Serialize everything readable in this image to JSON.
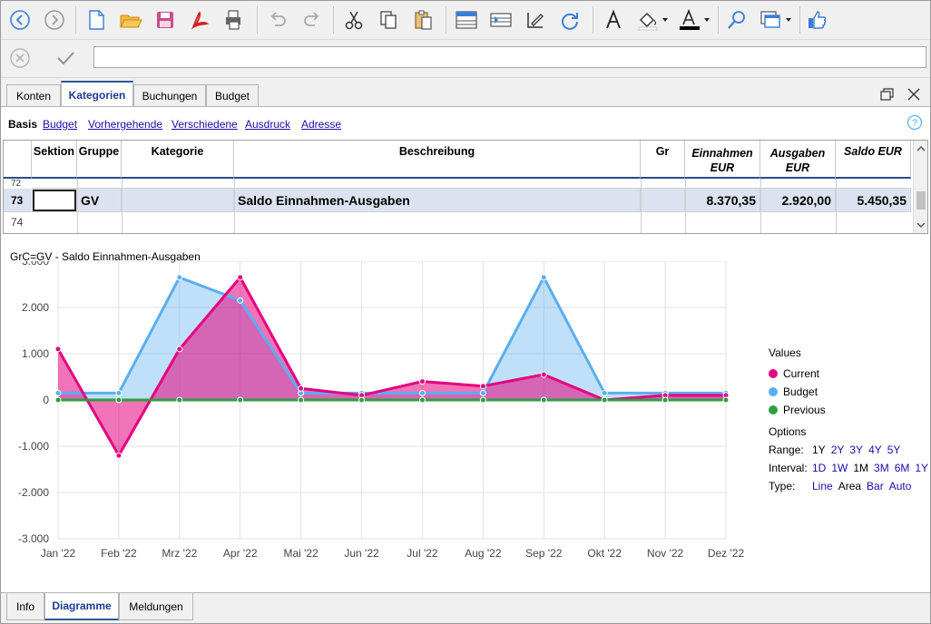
{
  "toolbar": {
    "buttons": [
      "back-icon",
      "forward-icon",
      "new-file-icon",
      "open-folder-icon",
      "save-icon",
      "pdf-icon",
      "print-icon",
      "undo-icon",
      "redo-icon",
      "cut-icon",
      "copy-icon",
      "paste-icon",
      "insert-row-icon",
      "add-rows-icon",
      "edit-icon",
      "refresh-icon",
      "font-icon",
      "fill-color-icon",
      "text-color-icon",
      "search-icon",
      "window-icon",
      "thumbs-up-icon"
    ]
  },
  "tabs": [
    "Konten",
    "Kategorien",
    "Buchungen",
    "Budget"
  ],
  "active_tab": "Kategorien",
  "views": [
    "Basis",
    "Budget",
    "Vorhergehende",
    "Verschiedene",
    "Ausdruck",
    "Adresse"
  ],
  "table": {
    "headers": {
      "sektion": "Sektion",
      "gruppe": "Gruppe",
      "kategorie": "Kategorie",
      "beschreibung": "Beschreibung",
      "gr": "Gr",
      "einnahmen_1": "Einnahmen",
      "einnahmen_2": "EUR",
      "ausgaben_1": "Ausgaben",
      "ausgaben_2": "EUR",
      "saldo": "Saldo EUR"
    },
    "rows": [
      {
        "num": "72"
      },
      {
        "num": "73",
        "gruppe": "GV",
        "beschreibung": "Saldo Einnahmen-Ausgaben",
        "einnahmen": "8.370,35",
        "ausgaben": "2.920,00",
        "saldo": "5.450,35"
      },
      {
        "num": "74"
      }
    ]
  },
  "chart_title": "GrC=GV - Saldo Einnahmen-Ausgaben",
  "chart_data": {
    "type": "area",
    "categories": [
      "Jan '22",
      "Feb '22",
      "Mrz '22",
      "Apr '22",
      "Mai '22",
      "Jun '22",
      "Jul '22",
      "Aug '22",
      "Sep '22",
      "Okt '22",
      "Nov '22",
      "Dez '22"
    ],
    "series": [
      {
        "name": "Current",
        "color": "#e6007e",
        "values": [
          1100,
          -1200,
          1100,
          2650,
          250,
          100,
          400,
          300,
          550,
          0,
          100,
          100
        ]
      },
      {
        "name": "Budget",
        "color": "#5aaef0",
        "values": [
          150,
          150,
          2650,
          2150,
          150,
          150,
          150,
          150,
          2650,
          150,
          150,
          150
        ]
      },
      {
        "name": "Previous",
        "color": "#2e9e3e",
        "values": [
          0,
          0,
          0,
          0,
          0,
          0,
          0,
          0,
          0,
          0,
          0,
          0
        ]
      }
    ],
    "y_ticks": [
      "3.000",
      "2.000",
      "1.000",
      "0",
      "-1.000",
      "-2.000",
      "-3.000"
    ],
    "ylim": [
      -3000,
      3000
    ],
    "grid": true,
    "legend": "right"
  },
  "legend": {
    "title": "Values",
    "items": [
      "Current",
      "Budget",
      "Previous"
    ],
    "colors": [
      "#e6007e",
      "#5aaef0",
      "#2e9e3e"
    ],
    "options_title": "Options",
    "range_label": "Range:",
    "range_options": [
      "1Y",
      "2Y",
      "3Y",
      "4Y",
      "5Y"
    ],
    "interval_label": "Interval:",
    "interval_options": [
      "1D",
      "1W",
      "1M",
      "3M",
      "6M",
      "1Y"
    ],
    "type_label": "Type:",
    "type_options": [
      "Line",
      "Area",
      "Bar",
      "Auto"
    ]
  },
  "bottom_tabs": [
    "Info",
    "Diagramme",
    "Meldungen"
  ],
  "active_bottom_tab": "Diagramme"
}
